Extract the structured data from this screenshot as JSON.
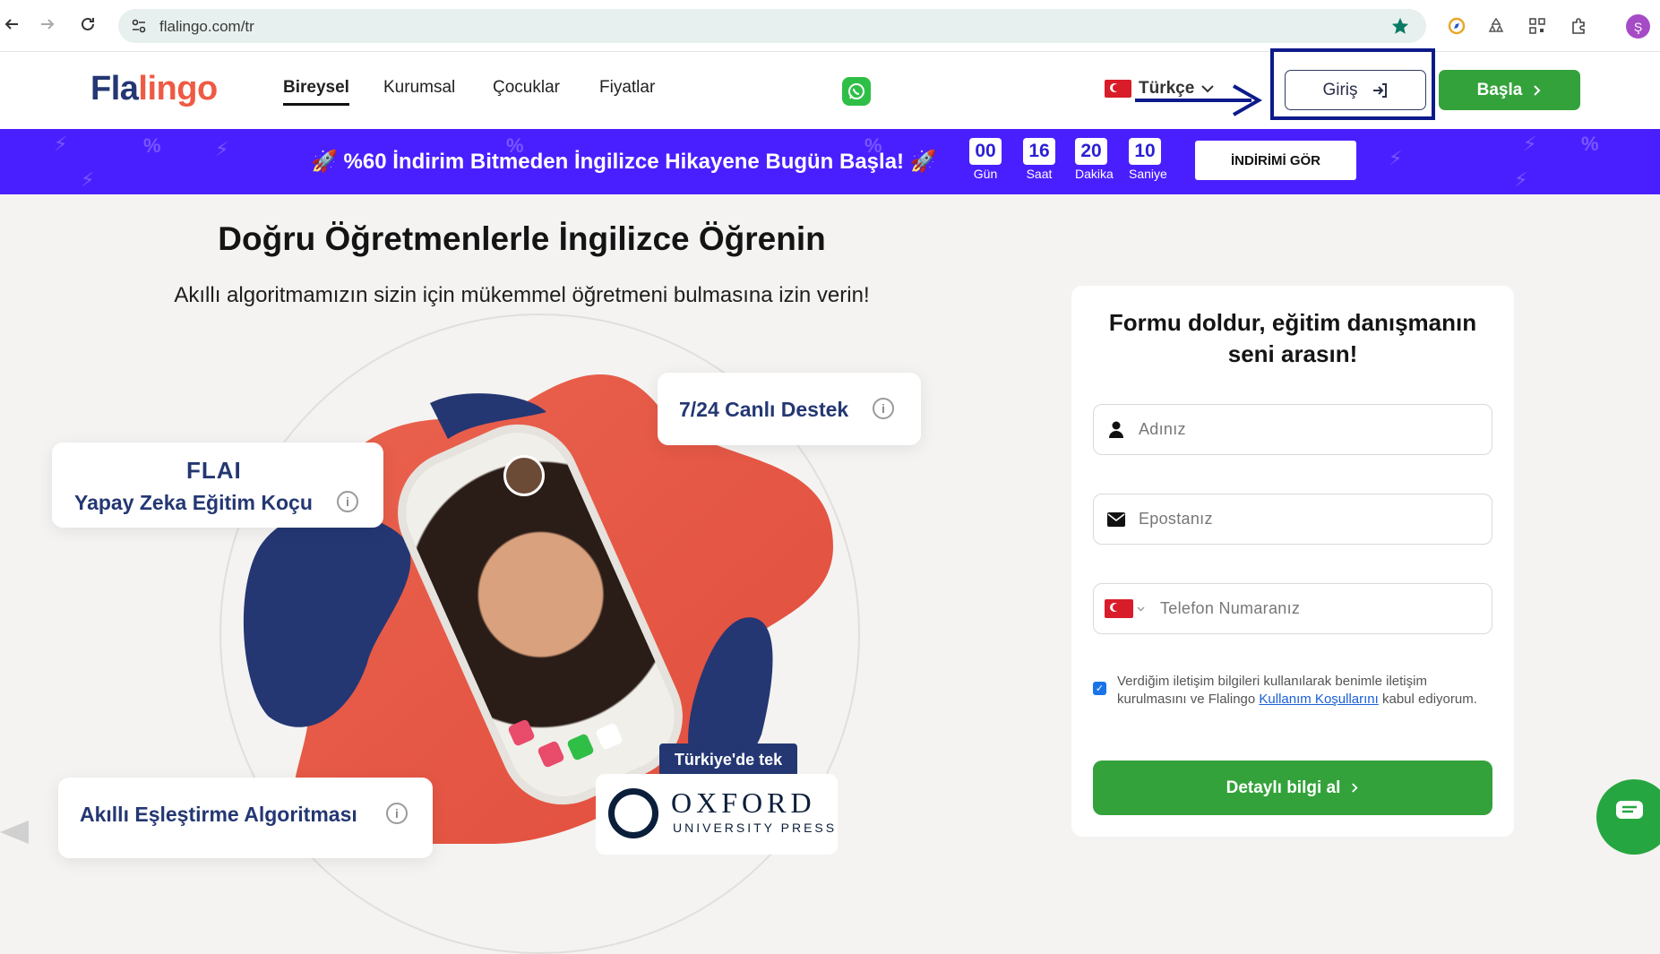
{
  "browser": {
    "url": "flalingo.com/tr",
    "profile_initial": "Ş"
  },
  "header": {
    "logo_part1": "Fla",
    "logo_part2": "lingo",
    "menu": [
      {
        "label": "Bireysel",
        "active": true
      },
      {
        "label": "Kurumsal",
        "active": false
      },
      {
        "label": "Çocuklar",
        "active": false
      },
      {
        "label": "Fiyatlar",
        "active": false
      }
    ],
    "language": "Türkçe",
    "login_label": "Giriş",
    "start_label": "Başla"
  },
  "promo": {
    "text": "🚀 %60 İndirim Bitmeden İngilizce Hikayene Bugün Başla! 🚀",
    "countdown": [
      {
        "value": "00",
        "label": "Gün"
      },
      {
        "value": "16",
        "label": "Saat"
      },
      {
        "value": "20",
        "label": "Dakika"
      },
      {
        "value": "10",
        "label": "Saniye"
      }
    ],
    "button_label": "İNDİRİMİ GÖR"
  },
  "hero": {
    "title": "Doğru Öğretmenlerle İngilizce Öğrenin",
    "subtitle": "Akıllı algoritmamızın sizin için mükemmel öğretmeni bulmasına izin verin!",
    "card_ai_logo": "FLAI",
    "card_ai_title": "Yapay Zeka Eğitim Koçu",
    "card_support": "7/24 Canlı Destek",
    "card_match": "Akıllı Eşleştirme Algoritması",
    "badge_tr": "Türkiye'de tek",
    "oxford_line1": "OXFORD",
    "oxford_line2": "UNIVERSITY PRESS"
  },
  "form": {
    "title": "Formu doldur, eğitim danışmanın seni arasın!",
    "name_placeholder": "Adınız",
    "email_placeholder": "Epostanız",
    "phone_placeholder": "Telefon Numaranız",
    "consent_before": "Verdiğim iletişim bilgileri kullanılarak benimle iletişim kurulmasını ve Flalingo ",
    "consent_link": "Kullanım Koşullarını",
    "consent_after": " kabul ediyorum.",
    "submit_label": "Detaylı bilgi al"
  },
  "colors": {
    "brand_navy": "#243773",
    "brand_coral": "#ee5a43",
    "cta_green": "#34a23b",
    "promo_purple": "#4a1fff",
    "highlight_box": "#0c1a8a"
  }
}
